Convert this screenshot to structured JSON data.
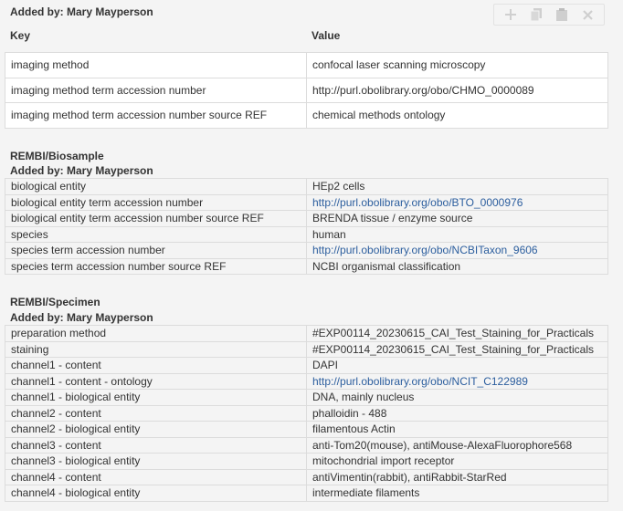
{
  "top_section": {
    "added_by": "Added by: Mary Mayperson",
    "toolbar": {
      "add_icon": "plus-icon",
      "copy_icon": "copy-icon",
      "paste_icon": "clipboard-icon",
      "delete_icon": "close-icon"
    },
    "columns": {
      "key": "Key",
      "value": "Value"
    },
    "rows": [
      {
        "key": "imaging method",
        "value": "confocal laser scanning microscopy"
      },
      {
        "key": "imaging method term accession number",
        "value": "http://purl.obolibrary.org/obo/CHMO_0000089"
      },
      {
        "key": "imaging method term accession number source REF",
        "value": "chemical methods ontology"
      }
    ]
  },
  "biosample": {
    "title": "REMBI/Biosample",
    "added_by": "Added by: Mary Mayperson",
    "rows": [
      {
        "key": "biological entity",
        "value": "HEp2 cells",
        "link": false
      },
      {
        "key": "biological entity term accession number",
        "value": "http://purl.obolibrary.org/obo/BTO_0000976",
        "link": true
      },
      {
        "key": "biological entity term accession number source REF",
        "value": "BRENDA tissue / enzyme source",
        "link": false
      },
      {
        "key": "species",
        "value": "human",
        "link": false
      },
      {
        "key": "species term accession number",
        "value": "http://purl.obolibrary.org/obo/NCBITaxon_9606",
        "link": true
      },
      {
        "key": "species term accession number source REF",
        "value": "NCBI organismal classification",
        "link": false
      }
    ]
  },
  "specimen": {
    "title": "REMBI/Specimen",
    "added_by": "Added by: Mary Mayperson",
    "rows": [
      {
        "key": "preparation method",
        "value": "#EXP00114_20230615_CAI_Test_Staining_for_Practicals",
        "link": false
      },
      {
        "key": "staining",
        "value": "#EXP00114_20230615_CAI_Test_Staining_for_Practicals",
        "link": false
      },
      {
        "key": "channel1 - content",
        "value": "DAPI",
        "link": false
      },
      {
        "key": "channel1 - content - ontology",
        "value": "http://purl.obolibrary.org/obo/NCIT_C122989",
        "link": true
      },
      {
        "key": "channel1 - biological entity",
        "value": "DNA, mainly nucleus",
        "link": false
      },
      {
        "key": "channel2 - content",
        "value": "phalloidin - 488",
        "link": false
      },
      {
        "key": "channel2 - biological entity",
        "value": "filamentous Actin",
        "link": false
      },
      {
        "key": "channel3 - content",
        "value": "anti-Tom20(mouse), antiMouse-AlexaFluorophore568",
        "link": false
      },
      {
        "key": "channel3 - biological entity",
        "value": "mitochondrial import receptor",
        "link": false
      },
      {
        "key": "channel4 - content",
        "value": "antiVimentin(rabbit), antiRabbit-StarRed",
        "link": false
      },
      {
        "key": "channel4 - biological entity",
        "value": "intermediate filaments",
        "link": false
      }
    ]
  }
}
